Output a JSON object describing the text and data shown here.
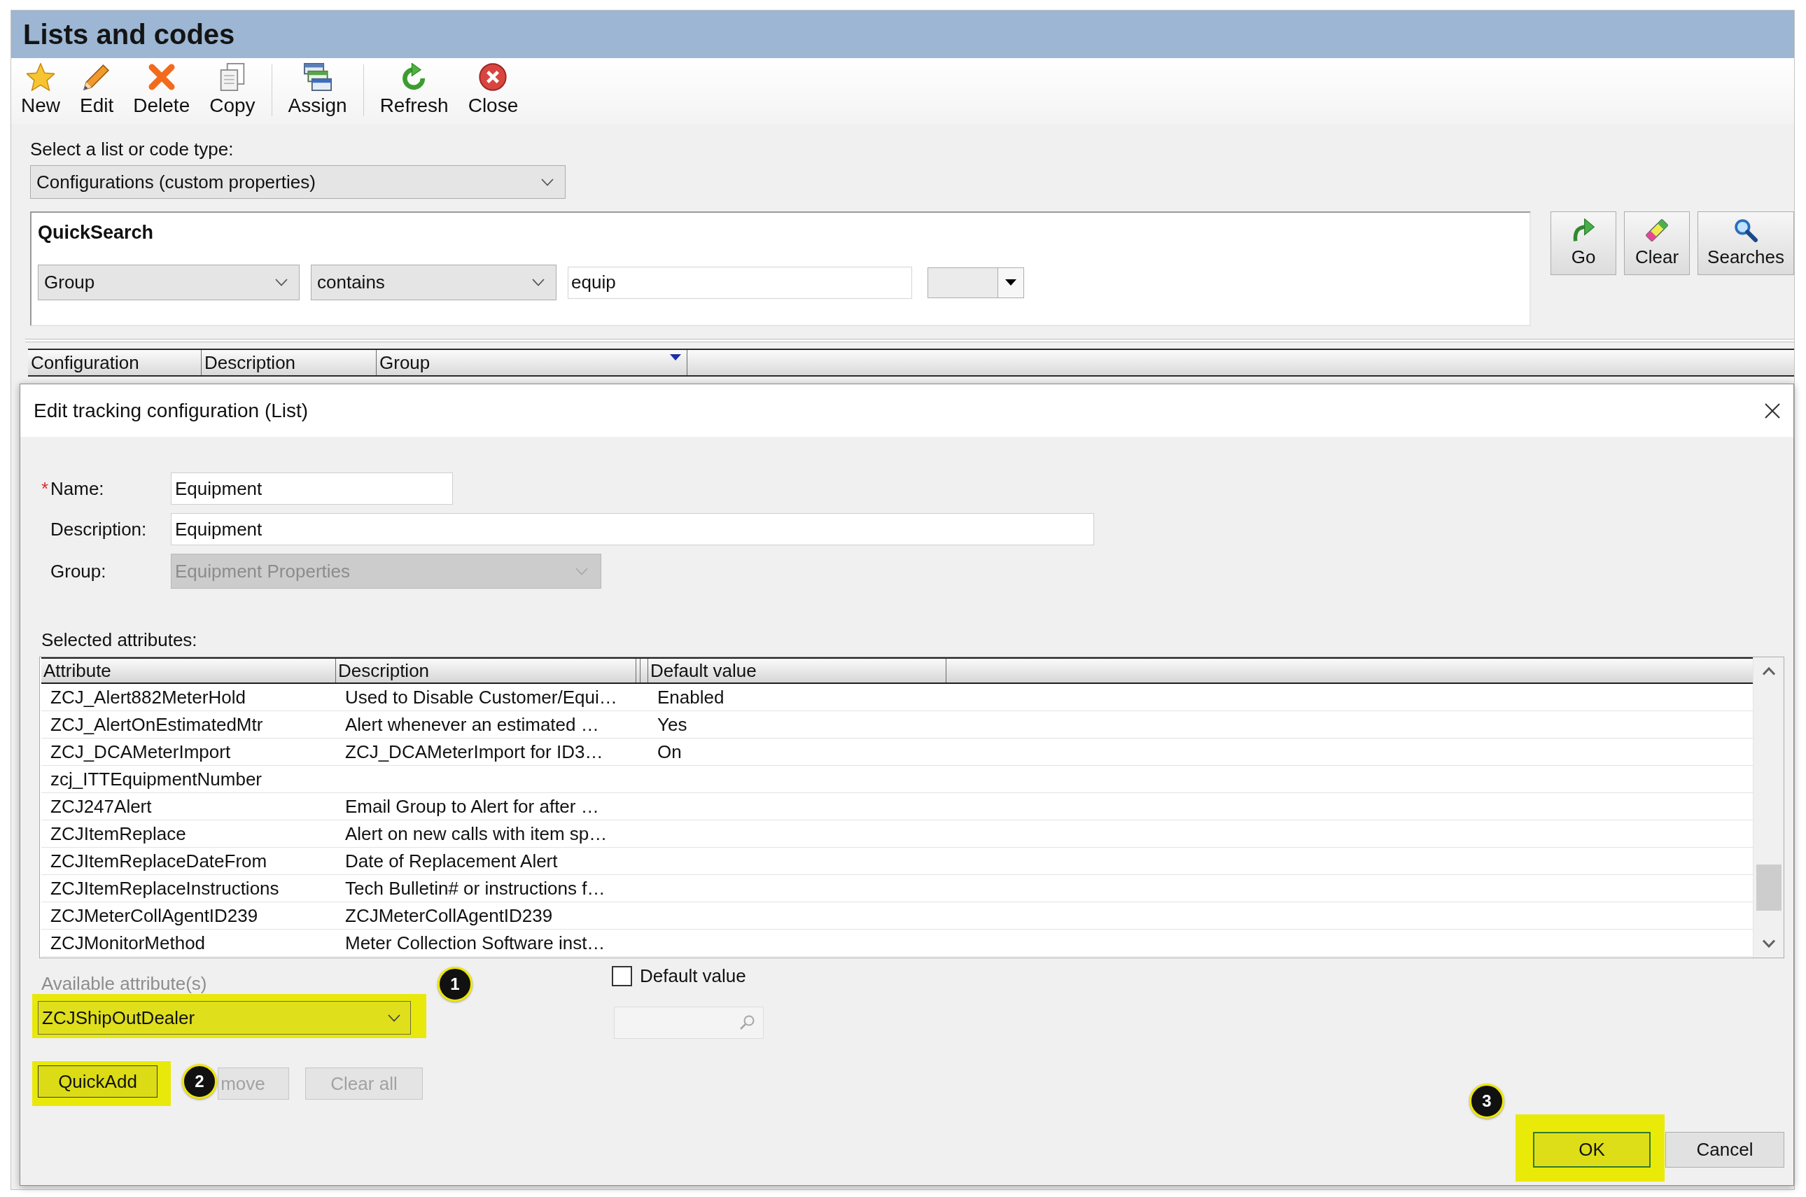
{
  "window": {
    "title": "Lists and codes"
  },
  "toolbar": [
    [
      "New",
      "Edit",
      "Delete",
      "Copy"
    ],
    [
      "Assign"
    ],
    [
      "Refresh",
      "Close"
    ]
  ],
  "list_type": {
    "label": "Select a list or code type:",
    "value": "Configurations (custom properties)"
  },
  "quick_search": {
    "title": "QuickSearch",
    "field": "Group",
    "operator": "contains",
    "value": "equip",
    "buttons": [
      "Go",
      "Clear",
      "Searches"
    ]
  },
  "grid": {
    "columns": [
      {
        "label": "Configuration",
        "sorted": false
      },
      {
        "label": "Description",
        "sorted": false
      },
      {
        "label": "Group",
        "sorted": true
      }
    ]
  },
  "dialog": {
    "title": "Edit tracking configuration (List)",
    "fields": [
      {
        "kind": "text",
        "required_mark": "*",
        "label": "Name:",
        "value": "Equipment",
        "disabled": false
      },
      {
        "kind": "text",
        "label": "Description:",
        "value": "Equipment",
        "disabled": false
      },
      {
        "kind": "select",
        "label": "Group:",
        "value": "Equipment Properties",
        "disabled": true
      }
    ],
    "attributes": {
      "label": "Selected attributes:",
      "columns": [
        "Attribute",
        "Description",
        "Default value"
      ],
      "rows": [
        {
          "attribute": "ZCJ_Alert882MeterHold",
          "description": "Used to Disable Customer/Equi…",
          "default_value": "Enabled"
        },
        {
          "attribute": "ZCJ_AlertOnEstimatedMtr",
          "description": "Alert whenever an estimated …",
          "default_value": "Yes"
        },
        {
          "attribute": "ZCJ_DCAMeterImport",
          "description": "ZCJ_DCAMeterImport for ID3…",
          "default_value": "On"
        },
        {
          "attribute": "zcj_ITTEquipmentNumber"
        },
        {
          "attribute": "ZCJ247Alert",
          "description": "Email Group to Alert for after …"
        },
        {
          "attribute": "ZCJItemReplace",
          "description": "Alert on new calls with item sp…"
        },
        {
          "attribute": "ZCJItemReplaceDateFrom",
          "description": "Date of Replacement Alert"
        },
        {
          "attribute": "ZCJItemReplaceInstructions",
          "description": "Tech Bulletin# or instructions f…"
        },
        {
          "attribute": "ZCJMeterCollAgentID239",
          "description": "ZCJMeterCollAgentID239"
        },
        {
          "attribute": "ZCJMonitorMethod",
          "description": "Meter Collection Software inst…"
        }
      ]
    },
    "available": {
      "label": "Available attribute(s)",
      "value": "ZCJShipOutDealer",
      "highlighted": true
    },
    "default_value": {
      "label": "Default value",
      "checked": false,
      "field_disabled": true
    },
    "actions": [
      {
        "label": "QuickAdd",
        "disabled": false,
        "highlighted": true
      },
      {
        "label": "move",
        "disabled": true,
        "highlighted": false
      },
      {
        "label": "Clear all",
        "disabled": true,
        "highlighted": false
      }
    ],
    "footer": [
      {
        "label": "OK",
        "default": true,
        "highlighted": true
      },
      {
        "label": "Cancel",
        "default": false,
        "highlighted": false
      }
    ],
    "callouts": [
      "1",
      "2",
      "3"
    ]
  }
}
